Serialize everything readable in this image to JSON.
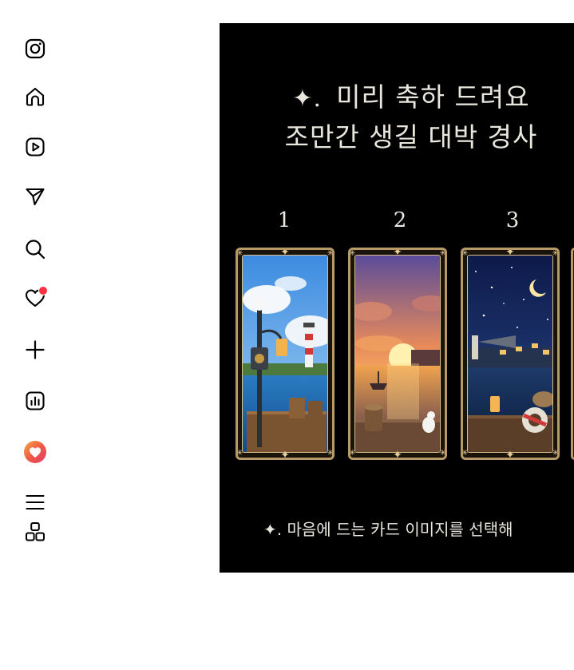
{
  "sidebar": {
    "items": [
      {
        "name": "instagram-logo-icon"
      },
      {
        "name": "home-icon"
      },
      {
        "name": "reels-icon"
      },
      {
        "name": "messages-icon"
      },
      {
        "name": "search-icon"
      },
      {
        "name": "notifications-heart-icon"
      },
      {
        "name": "create-plus-icon"
      },
      {
        "name": "dashboard-icon"
      },
      {
        "name": "profile-avatar"
      },
      {
        "name": "more-menu-icon"
      },
      {
        "name": "also-from-meta-icon"
      }
    ],
    "notification_dot_color": "#ff3040"
  },
  "post": {
    "title_sparkle": "✦.",
    "title_line1": "미리 축하 드려요",
    "title_line2": "조만간 생길 대박 경사",
    "cards": [
      {
        "number": "1",
        "scene": "harbor lighthouse daytime"
      },
      {
        "number": "2",
        "scene": "harbor sunset"
      },
      {
        "number": "3",
        "scene": "harbor night moon"
      }
    ],
    "caption": "✦. 마음에 드는 카드 이미지를 선택해"
  },
  "colors": {
    "post_background": "#000000",
    "card_frame": "#b89a66",
    "text_light": "#e9e6de"
  }
}
